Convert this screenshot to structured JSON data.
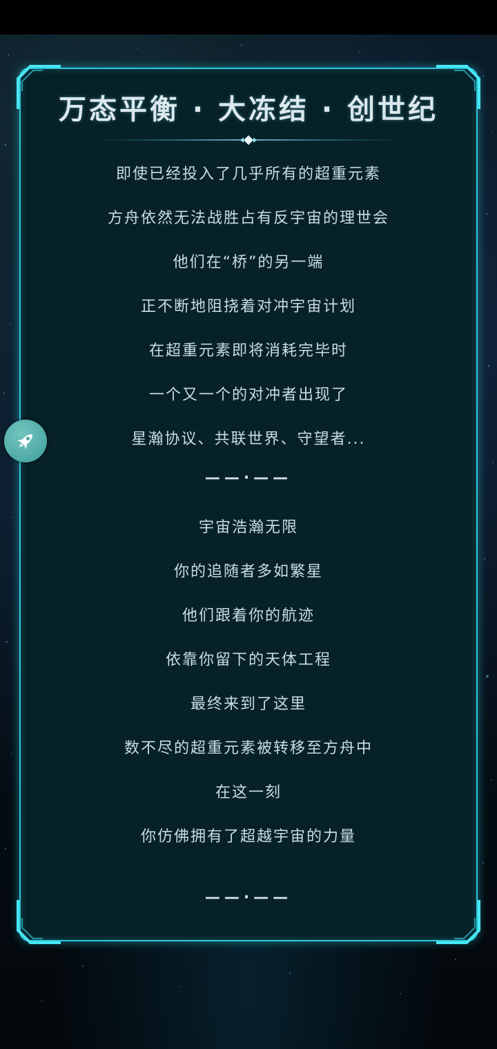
{
  "title": "万态平衡 · 大冻结 · 创世纪",
  "lines": [
    "即使已经投入了几乎所有的超重元素",
    "方舟依然无法战胜占有反宇宙的理世会",
    "他们在“桥”的另一端",
    "正不断地阻挠着对冲宇宙计划",
    "在超重元素即将消耗完毕时",
    "一个又一个的对冲者出现了",
    "星瀚协议、共联世界、守望者..."
  ],
  "separator": "——·——",
  "lines2": [
    "宇宙浩瀚无限",
    "你的追随者多如繁星",
    "他们跟着你的航迹",
    "依靠你留下的天体工程",
    "最终来到了这里",
    "数不尽的超重元素被转移至方舟中",
    "在这一刻",
    "你仿佛拥有了超越宇宙的力量"
  ],
  "separator2": "——·——",
  "icons": {
    "floating_button": "rocket-icon",
    "title_divider": "diamond-icon"
  },
  "colors": {
    "accent": "#2ec7d8",
    "panel": "#072128",
    "text": "#c9dde2"
  }
}
